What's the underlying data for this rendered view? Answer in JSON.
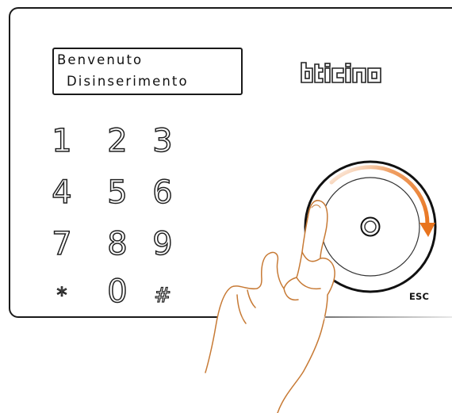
{
  "display": {
    "line1": "Benvenuto",
    "line2": "Disinserimento"
  },
  "brand": {
    "name": "bticino"
  },
  "keypad": {
    "keys": [
      "1",
      "2",
      "3",
      "4",
      "5",
      "6",
      "7",
      "8",
      "9",
      "*",
      "0",
      "#"
    ]
  },
  "knob": {
    "esc_label": "ESC"
  },
  "colors": {
    "accent": "#e8741e",
    "outline": "#1a1a1a"
  },
  "icons": {
    "hand": "pointing-hand-icon",
    "arrow": "rotate-clockwise-arrow-icon"
  }
}
